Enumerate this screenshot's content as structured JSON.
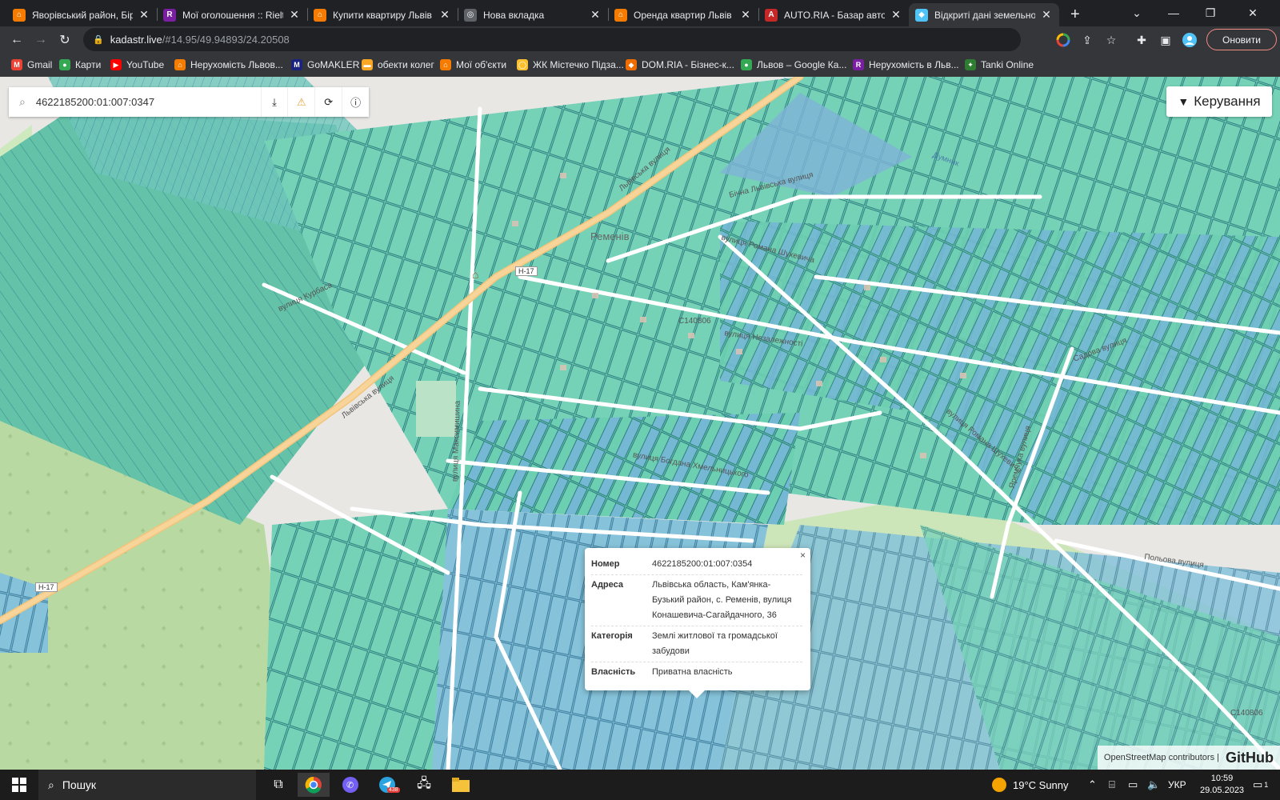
{
  "browser": {
    "tabs": [
      {
        "title": "Яворівський район, Бірк",
        "color": "#f57c00",
        "letter": "⌂"
      },
      {
        "title": "Мої оголошення :: Rielto",
        "color": "#7b1fa2",
        "letter": "R"
      },
      {
        "title": "Купити квартиру Львів -",
        "color": "#f57c00",
        "letter": "⌂"
      },
      {
        "title": "Нова вкладка",
        "color": "#5f6368",
        "letter": "◎"
      },
      {
        "title": "Оренда квартир Львів д",
        "color": "#f57c00",
        "letter": "⌂"
      },
      {
        "title": "AUTO.RIA - Базар авто N",
        "color": "#c62828",
        "letter": "A"
      },
      {
        "title": "Відкриті дані земельног",
        "color": "#4fc3f7",
        "letter": "◆"
      }
    ],
    "url_host": "kadastr.live",
    "url_path": "/#14.95/49.94893/24.20508",
    "update_label": "Оновити",
    "bookmarks": [
      {
        "label": "Gmail",
        "color": "#ea4335",
        "letter": "M"
      },
      {
        "label": "Карти",
        "color": "#34a853",
        "letter": "●"
      },
      {
        "label": "YouTube",
        "color": "#ff0000",
        "letter": "▶"
      },
      {
        "label": "Нерухомість Львов...",
        "color": "#f57c00",
        "letter": "⌂"
      },
      {
        "label": "GoMAKLER",
        "color": "#1a237e",
        "letter": "M"
      },
      {
        "label": "обекти колег",
        "color": "#f9a825",
        "letter": "▬"
      },
      {
        "label": "Мої об'єкти",
        "color": "#f57c00",
        "letter": "⌂"
      },
      {
        "label": "ЖК Містечко Підза...",
        "color": "#fbc02d",
        "letter": "◯"
      },
      {
        "label": "DOM.RIA - Бізнес-к...",
        "color": "#ef6c00",
        "letter": "◆"
      },
      {
        "label": "Львов – Google Ка...",
        "color": "#34a853",
        "letter": "●"
      },
      {
        "label": "Нерухомість в Льв...",
        "color": "#7b1fa2",
        "letter": "R"
      },
      {
        "label": "Tanki Online",
        "color": "#2e7d32",
        "letter": "✦"
      }
    ]
  },
  "map": {
    "search_value": "4622185200:01:007:0347",
    "control_label": "Керування",
    "labels": {
      "village": "Ременів",
      "road_h17": "Н-17",
      "road_c140806": "С140806",
      "lvivska": "Львівська вулиця",
      "shukhevycha": "вулиця Романа Шухевича",
      "nezalezhnosti": "вулиця Незалежності",
      "khmelnytskoho": "вулиця Богдана Хмельницького",
      "sadova": "Садова вулиця",
      "polova": "Польова вулиця",
      "kurbasa": "вулиця Курбаса",
      "dunaiets": "Думник",
      "bichna": "Бічна Львівська вулиця",
      "yaremchuka": "Яремчука вулиця",
      "maksymyshyna": "вулиця Максимишина"
    },
    "popup": {
      "rows": [
        {
          "key": "Номер",
          "value": "4622185200:01:007:0354"
        },
        {
          "key": "Адреса",
          "value": "Львівська область, Кам'янка-Бузький район, с. Ременів, вулиця Конашевича-Сагайдачного, 36"
        },
        {
          "key": "Категорія",
          "value": "Землі житлової та громадської забудови"
        },
        {
          "key": "Власність",
          "value": "Приватна власність"
        }
      ],
      "close": "×"
    },
    "attribution": "OpenStreetMap contributors |",
    "attribution_brand": "GitHub"
  },
  "taskbar": {
    "search_placeholder": "Пошук",
    "weather": "19°C  Sunny",
    "lang": "УКР",
    "time": "10:59",
    "date": "29.05.2023",
    "notif_count": "1",
    "telegram_badge": "438"
  }
}
